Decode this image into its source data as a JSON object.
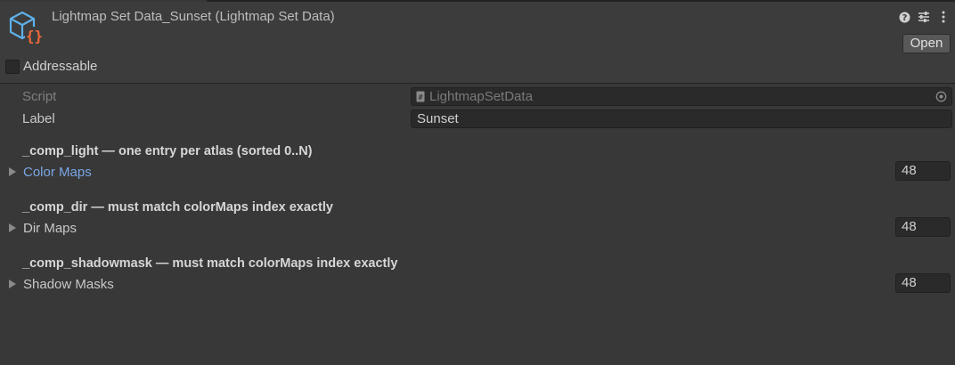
{
  "header": {
    "title": "Lightmap Set Data_Sunset (Lightmap Set Data)",
    "open_label": "Open",
    "asset_icon": "scriptable-object-icon",
    "tools": [
      "help-icon",
      "presets-icon",
      "more-icon"
    ]
  },
  "addressable": {
    "label": "Addressable",
    "checked": false
  },
  "properties": {
    "script": {
      "label": "Script",
      "value": "LightmapSetData"
    },
    "label": {
      "label": "Label",
      "value": "Sunset"
    }
  },
  "sections": [
    {
      "header": "_comp_light — one entry per atlas (sorted 0..N)",
      "list_label": "Color Maps",
      "size": "48"
    },
    {
      "header": "_comp_dir — must match colorMaps index exactly",
      "list_label": "Dir Maps",
      "size": "48"
    },
    {
      "header": "_comp_shadowmask — must match colorMaps index exactly",
      "list_label": "Shadow Masks",
      "size": "48"
    }
  ],
  "colors": {
    "background": "#383838",
    "header_background": "#3c3c3c",
    "field_background": "#2a2a2a",
    "link_label": "#7aa7e6",
    "icon_accent": "#f06a3a",
    "icon_primary": "#5fb0e8"
  }
}
